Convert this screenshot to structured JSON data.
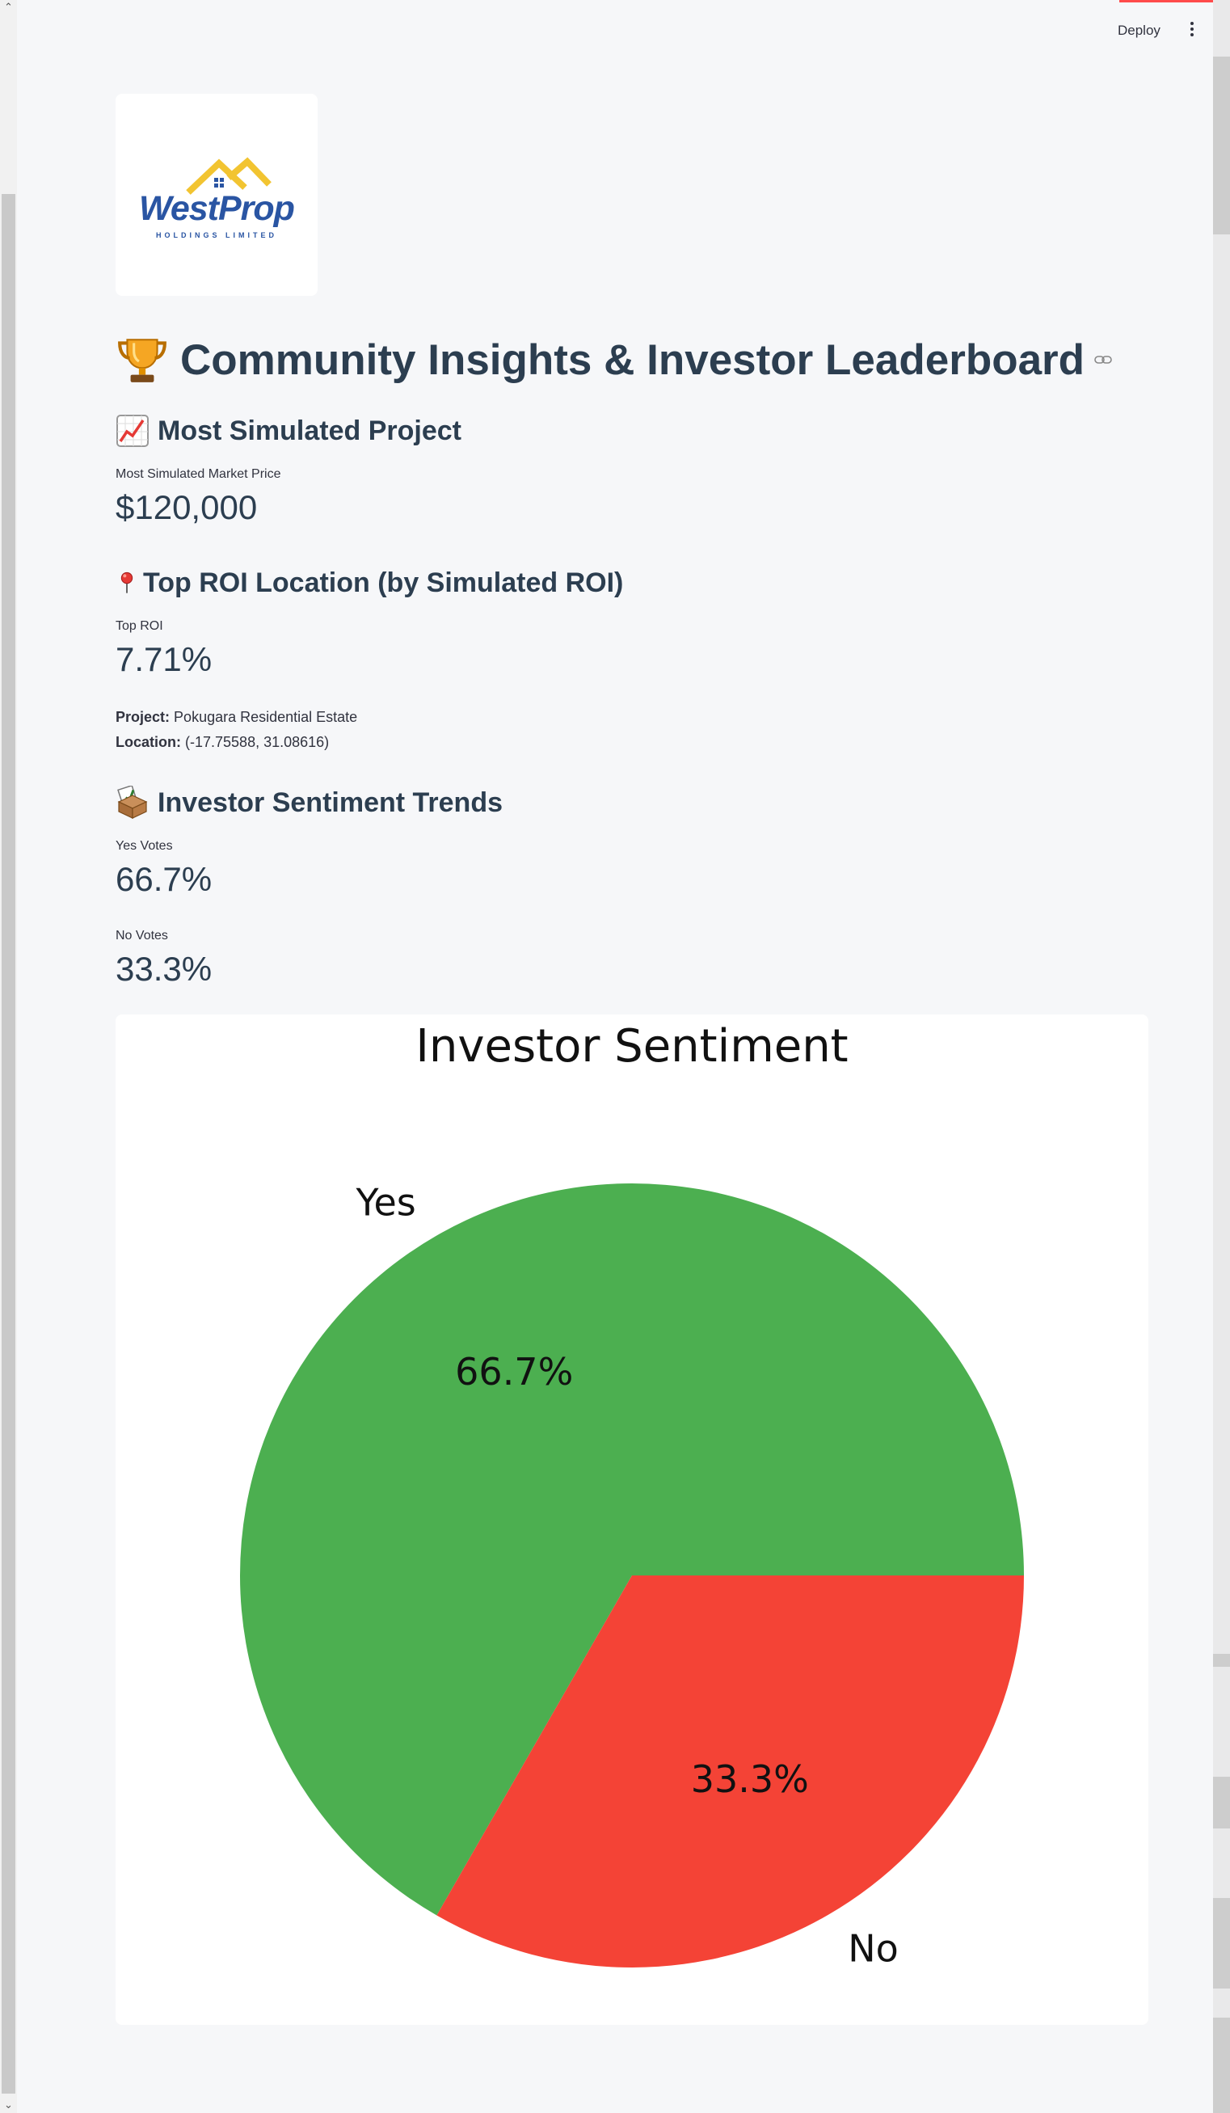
{
  "toolbar": {
    "deploy_label": "Deploy"
  },
  "logo": {
    "brand": "WestProp",
    "subtitle": "HOLDINGS LIMITED",
    "colors": {
      "roof": "#f2c431",
      "text": "#2a55a3"
    }
  },
  "header": {
    "title": "Community Insights & Investor Leaderboard",
    "title_icon": "trophy-icon"
  },
  "sections": {
    "most_simulated": {
      "heading": "Most Simulated Project",
      "icon": "chart-increasing-icon",
      "metric_label": "Most Simulated Market Price",
      "metric_value": "$120,000"
    },
    "top_roi": {
      "heading": "Top ROI Location (by Simulated ROI)",
      "icon": "pushpin-icon",
      "metric_label": "Top ROI",
      "metric_value": "7.71%",
      "project_key": "Project:",
      "project_value": "Pokugara Residential Estate",
      "location_key": "Location:",
      "location_value": "(-17.75588, 31.08616)"
    },
    "sentiment": {
      "heading": "Investor Sentiment Trends",
      "icon": "ballot-box-icon",
      "yes_label": "Yes Votes",
      "yes_value": "66.7%",
      "no_label": "No Votes",
      "no_value": "33.3%"
    }
  },
  "chart_data": {
    "type": "pie",
    "title": "Investor Sentiment",
    "categories": [
      "Yes",
      "No"
    ],
    "values": [
      66.7,
      33.3
    ],
    "autopct_labels": [
      "66.7%",
      "33.3%"
    ],
    "colors": [
      "#4caf50",
      "#f44336"
    ],
    "start_angle": 0,
    "direction": "counterclockwise"
  }
}
